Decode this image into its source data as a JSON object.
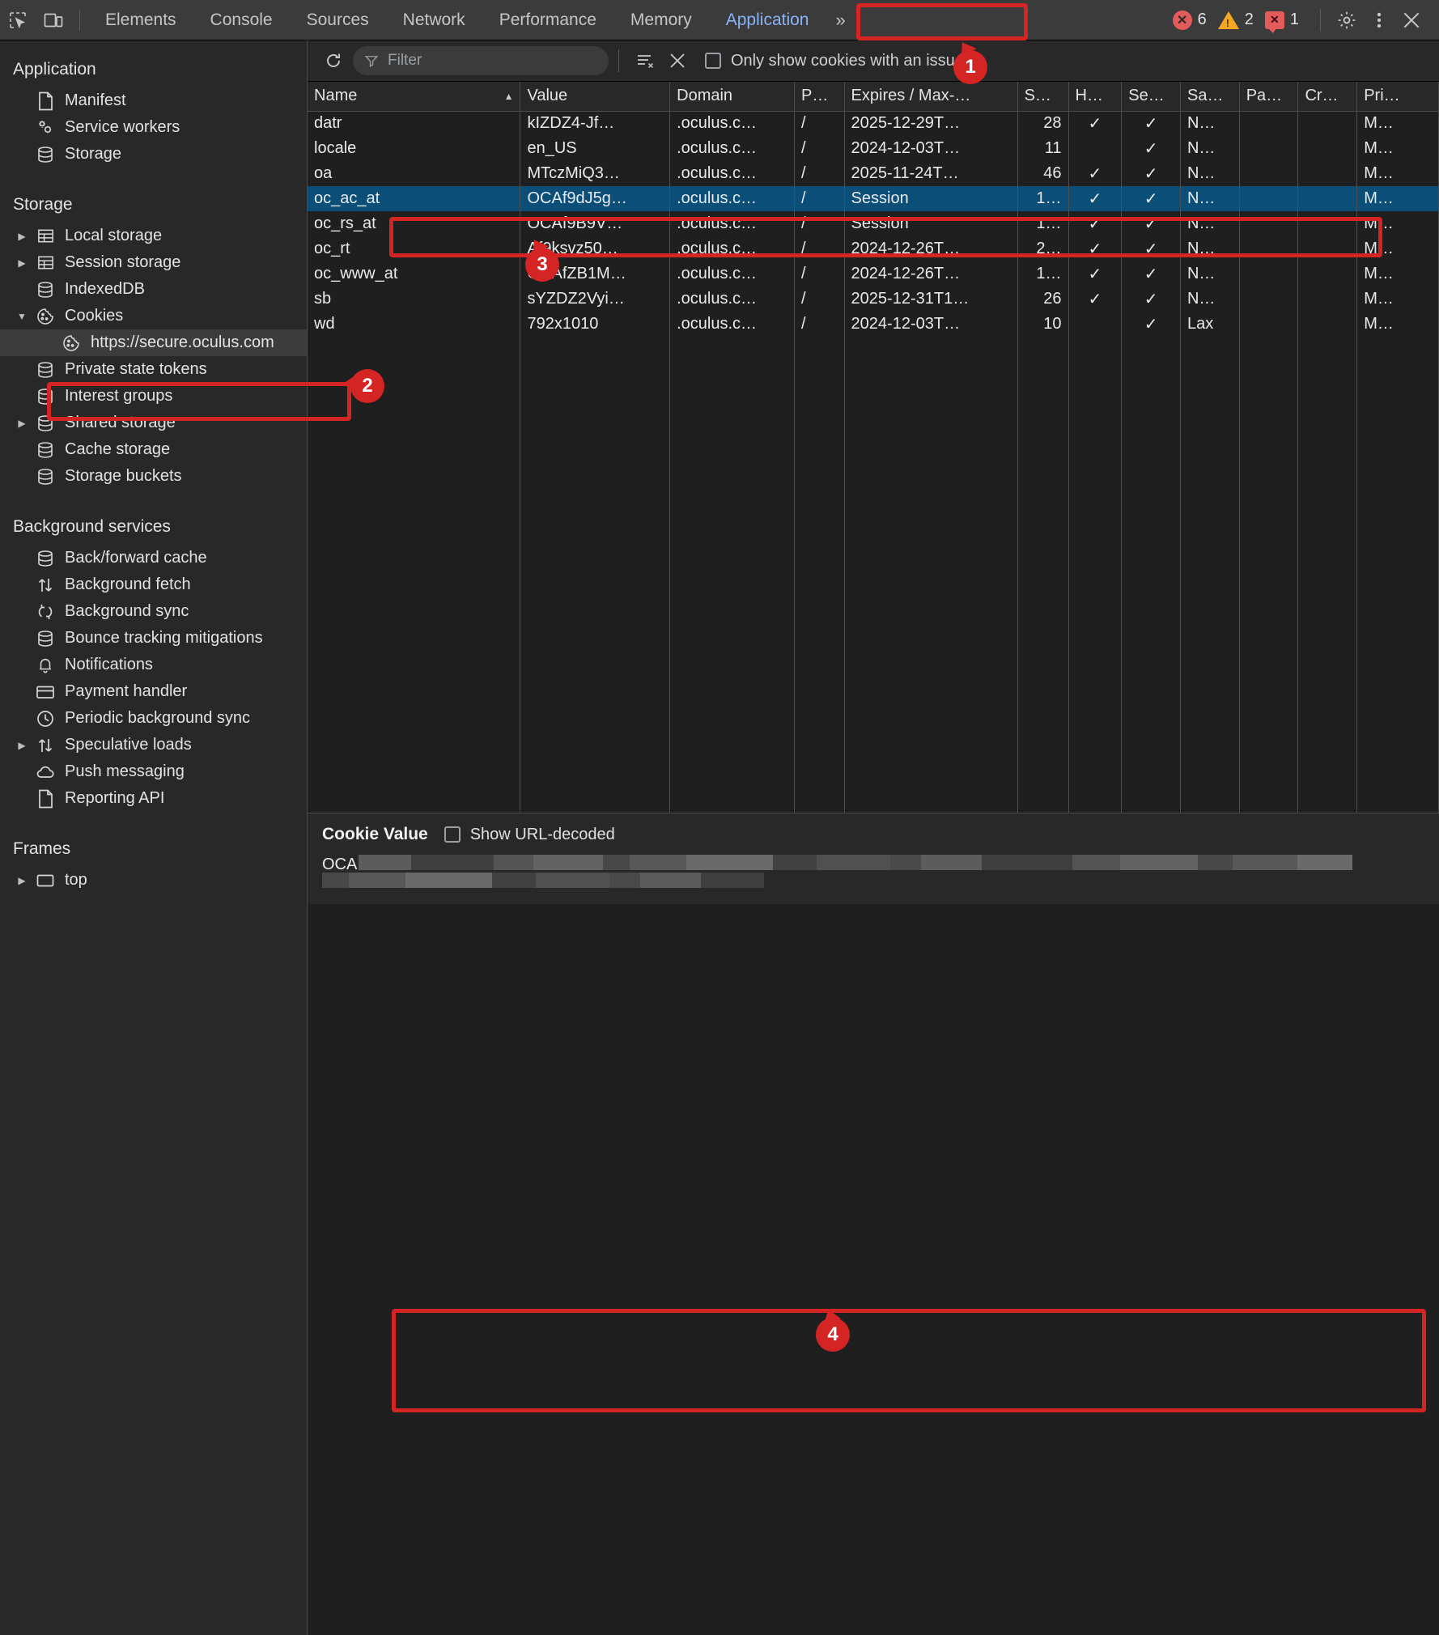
{
  "toolbar": {
    "icons": [
      {
        "name": "inspect-element-icon",
        "glyph": "inspect"
      },
      {
        "name": "device-toolbar-icon",
        "glyph": "device"
      }
    ],
    "tabs": [
      {
        "label": "Elements",
        "active": false
      },
      {
        "label": "Console",
        "active": false
      },
      {
        "label": "Sources",
        "active": false
      },
      {
        "label": "Network",
        "active": false
      },
      {
        "label": "Performance",
        "active": false
      },
      {
        "label": "Memory",
        "active": false
      },
      {
        "label": "Application",
        "active": true
      }
    ],
    "more_tabs_glyph": "»",
    "counters": {
      "errors": "6",
      "warnings": "2",
      "messages": "1"
    },
    "settings_label": "Settings",
    "more_options_label": "Customize and control DevTools",
    "close_label": "Close DevTools"
  },
  "sidebar": {
    "sections": [
      {
        "title": "Application",
        "items": [
          {
            "label": "Manifest",
            "icon": "manifest-icon",
            "arrow": "none",
            "selected": false
          },
          {
            "label": "Service workers",
            "icon": "service-workers-icon",
            "arrow": "none",
            "selected": false
          },
          {
            "label": "Storage",
            "icon": "storage-icon",
            "arrow": "none",
            "selected": false
          }
        ]
      },
      {
        "title": "Storage",
        "items": [
          {
            "label": "Local storage",
            "icon": "table-icon",
            "arrow": "collapsed",
            "selected": false
          },
          {
            "label": "Session storage",
            "icon": "table-icon",
            "arrow": "collapsed",
            "selected": false
          },
          {
            "label": "IndexedDB",
            "icon": "database-icon",
            "arrow": "none",
            "selected": false
          },
          {
            "label": "Cookies",
            "icon": "cookie-icon",
            "arrow": "expanded",
            "selected": false
          },
          {
            "label": "https://secure.oculus.com",
            "icon": "cookie-icon",
            "arrow": "none",
            "selected": true,
            "child": true
          },
          {
            "label": "Private state tokens",
            "icon": "database-icon",
            "arrow": "none",
            "selected": false
          },
          {
            "label": "Interest groups",
            "icon": "database-icon",
            "arrow": "none",
            "selected": false
          },
          {
            "label": "Shared storage",
            "icon": "database-icon",
            "arrow": "collapsed",
            "selected": false
          },
          {
            "label": "Cache storage",
            "icon": "database-icon",
            "arrow": "none",
            "selected": false
          },
          {
            "label": "Storage buckets",
            "icon": "database-icon",
            "arrow": "none",
            "selected": false
          }
        ]
      },
      {
        "title": "Background services",
        "items": [
          {
            "label": "Back/forward cache",
            "icon": "database-icon",
            "arrow": "none",
            "selected": false
          },
          {
            "label": "Background fetch",
            "icon": "fetch-icon",
            "arrow": "none",
            "selected": false
          },
          {
            "label": "Background sync",
            "icon": "sync-icon",
            "arrow": "none",
            "selected": false
          },
          {
            "label": "Bounce tracking mitigations",
            "icon": "database-icon",
            "arrow": "none",
            "selected": false
          },
          {
            "label": "Notifications",
            "icon": "bell-icon",
            "arrow": "none",
            "selected": false
          },
          {
            "label": "Payment handler",
            "icon": "card-icon",
            "arrow": "none",
            "selected": false
          },
          {
            "label": "Periodic background sync",
            "icon": "clock-icon",
            "arrow": "none",
            "selected": false
          },
          {
            "label": "Speculative loads",
            "icon": "fetch-icon",
            "arrow": "collapsed",
            "selected": false
          },
          {
            "label": "Push messaging",
            "icon": "cloud-icon",
            "arrow": "none",
            "selected": false
          },
          {
            "label": "Reporting API",
            "icon": "manifest-icon",
            "arrow": "none",
            "selected": false
          }
        ]
      },
      {
        "title": "Frames",
        "items": [
          {
            "label": "top",
            "icon": "frame-icon",
            "arrow": "collapsed",
            "selected": false
          }
        ]
      }
    ]
  },
  "filterbar": {
    "refresh_label": "Refresh",
    "filter_placeholder": "Filter",
    "clear_filtered_label": "Clear filtered cookies",
    "clear_all_label": "Clear all cookies",
    "only_issues_label": "Only show cookies with an issue",
    "only_issues_checked": false
  },
  "table": {
    "columns": [
      {
        "key": "name",
        "label": "Name",
        "sorted": "asc"
      },
      {
        "key": "value",
        "label": "Value"
      },
      {
        "key": "domain",
        "label": "Domain"
      },
      {
        "key": "path",
        "label": "P…"
      },
      {
        "key": "expires",
        "label": "Expires / Max-…"
      },
      {
        "key": "size",
        "label": "S…"
      },
      {
        "key": "httponly",
        "label": "H…"
      },
      {
        "key": "secure",
        "label": "Se…"
      },
      {
        "key": "samesite",
        "label": "Sa…"
      },
      {
        "key": "partition",
        "label": "Pa…"
      },
      {
        "key": "crosssite",
        "label": "Cr…"
      },
      {
        "key": "priority",
        "label": "Pri…"
      }
    ],
    "rows": [
      {
        "name": "datr",
        "value": "kIZDZ4-Jf…",
        "domain": ".oculus.c…",
        "path": "/",
        "expires": "2025-12-29T…",
        "size": "28",
        "httponly": "✓",
        "secure": "✓",
        "samesite": "N…",
        "partition": "",
        "crosssite": "",
        "priority": "M…",
        "selected": false
      },
      {
        "name": "locale",
        "value": "en_US",
        "domain": ".oculus.c…",
        "path": "/",
        "expires": "2024-12-03T…",
        "size": "11",
        "httponly": "",
        "secure": "✓",
        "samesite": "N…",
        "partition": "",
        "crosssite": "",
        "priority": "M…",
        "selected": false
      },
      {
        "name": "oa",
        "value": "MTczMiQ3…",
        "domain": ".oculus.c…",
        "path": "/",
        "expires": "2025-11-24T…",
        "size": "46",
        "httponly": "✓",
        "secure": "✓",
        "samesite": "N…",
        "partition": "",
        "crosssite": "",
        "priority": "M…",
        "selected": false
      },
      {
        "name": "oc_ac_at",
        "value": "OCAf9dJ5g…",
        "domain": ".oculus.c…",
        "path": "/",
        "expires": "Session",
        "size": "1…",
        "httponly": "✓",
        "secure": "✓",
        "samesite": "N…",
        "partition": "",
        "crosssite": "",
        "priority": "M…",
        "selected": true
      },
      {
        "name": "oc_rs_at",
        "value": "OCAf9B9V…",
        "domain": ".oculus.c…",
        "path": "/",
        "expires": "Session",
        "size": "1…",
        "httponly": "✓",
        "secure": "✓",
        "samesite": "N…",
        "partition": "",
        "crosssite": "",
        "priority": "M…",
        "selected": false
      },
      {
        "name": "oc_rt",
        "value": "Af9ksvz50…",
        "domain": ".oculus.c…",
        "path": "/",
        "expires": "2024-12-26T…",
        "size": "2…",
        "httponly": "✓",
        "secure": "✓",
        "samesite": "N…",
        "partition": "",
        "crosssite": "",
        "priority": "M…",
        "selected": false
      },
      {
        "name": "oc_www_at",
        "value": "OCAfZB1M…",
        "domain": ".oculus.c…",
        "path": "/",
        "expires": "2024-12-26T…",
        "size": "1…",
        "httponly": "✓",
        "secure": "✓",
        "samesite": "N…",
        "partition": "",
        "crosssite": "",
        "priority": "M…",
        "selected": false
      },
      {
        "name": "sb",
        "value": "sYZDZ2Vyi…",
        "domain": ".oculus.c…",
        "path": "/",
        "expires": "2025-12-31T1…",
        "size": "26",
        "httponly": "✓",
        "secure": "✓",
        "samesite": "N…",
        "partition": "",
        "crosssite": "",
        "priority": "M…",
        "selected": false
      },
      {
        "name": "wd",
        "value": "792x1010",
        "domain": ".oculus.c…",
        "path": "/",
        "expires": "2024-12-03T…",
        "size": "10",
        "httponly": "",
        "secure": "✓",
        "samesite": "Lax",
        "partition": "",
        "crosssite": "",
        "priority": "M…",
        "selected": false
      }
    ]
  },
  "cookie_value_panel": {
    "title": "Cookie Value",
    "show_url_decoded_label": "Show URL-decoded",
    "show_url_decoded_checked": false,
    "value_prefix": "OCA",
    "value_redacted": true
  },
  "annotations": [
    {
      "number": "1",
      "target": "application-tab"
    },
    {
      "number": "2",
      "target": "cookies-origin-item"
    },
    {
      "number": "3",
      "target": "oc-ac-at-row"
    },
    {
      "number": "4",
      "target": "cookie-value-panel"
    }
  ],
  "colors": {
    "accent_blue": "#8ab4f8",
    "selected_row": "#0b4f79",
    "annotation_red": "#d42424",
    "error_red": "#e45b5b",
    "warning_orange": "#f5a623"
  }
}
